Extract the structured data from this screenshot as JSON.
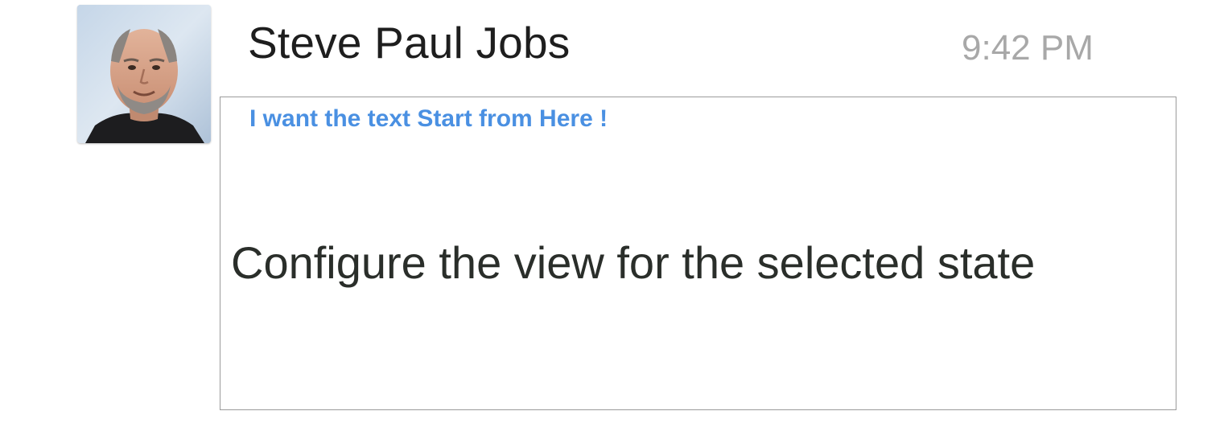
{
  "message": {
    "sender_name": "Steve Paul Jobs",
    "timestamp": "9:42 PM",
    "annotation": "I want the text Start from Here !",
    "body": "Configure the view for the selected state"
  },
  "colors": {
    "annotation": "#4a90e2",
    "timestamp": "#a8a8a8",
    "sender_name": "#1e1e1e",
    "body_text": "#2a2e2a",
    "box_border": "#9b9b9b"
  },
  "icons": {
    "avatar": "profile-photo"
  }
}
